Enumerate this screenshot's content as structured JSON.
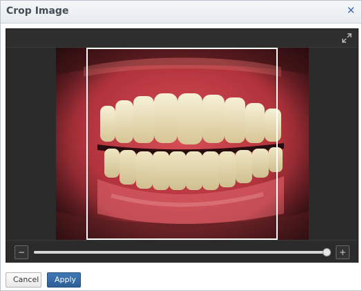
{
  "dialog": {
    "title": "Crop Image",
    "close_icon": "close-icon",
    "expand_icon": "expand-icon"
  },
  "editor": {
    "image_description": "",
    "zoom": {
      "minus_label": "−",
      "plus_label": "+",
      "level_fraction": 1.0
    }
  },
  "footer": {
    "cancel_label": "Cancel",
    "apply_label": "Apply"
  },
  "colors": {
    "accent": "#3f6fa8",
    "apply_button": "#346aa6",
    "editor_bg": "#2b2b2b",
    "crop_border": "#ffffff"
  }
}
